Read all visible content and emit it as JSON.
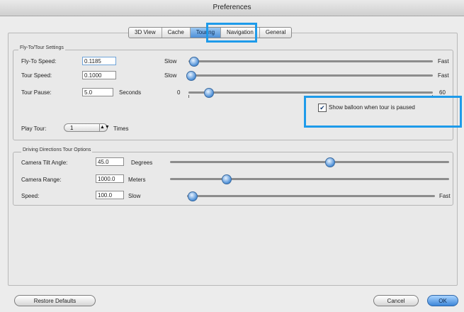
{
  "window": {
    "title": "Preferences"
  },
  "tabs": [
    {
      "label": "3D View",
      "active": false
    },
    {
      "label": "Cache",
      "active": false
    },
    {
      "label": "Touring",
      "active": true
    },
    {
      "label": "Navigation",
      "active": false
    },
    {
      "label": "General",
      "active": false
    }
  ],
  "fly_to_tour": {
    "legend": "Fly-To/Tour Settings",
    "fly_to_speed": {
      "label": "Fly-To Speed:",
      "value": "0.1185",
      "min_label": "Slow",
      "max_label": "Fast",
      "level": 0.02
    },
    "tour_speed": {
      "label": "Tour Speed:",
      "value": "0.1000",
      "min_label": "Slow",
      "max_label": "Fast",
      "level": 0.01
    },
    "tour_pause": {
      "label": "Tour Pause:",
      "value": "5.0",
      "unit": "Seconds",
      "min_label": "0",
      "max_label": "60",
      "level": 0.08
    },
    "show_balloon": {
      "label": "Show balloon when tour is paused",
      "checked": true
    },
    "play_tour": {
      "label": "Play Tour:",
      "value": "1",
      "unit": "Times"
    }
  },
  "driving": {
    "legend": "Driving Directions Tour Options",
    "tilt": {
      "label": "Camera Tilt Angle:",
      "value": "45.0",
      "unit": "Degrees",
      "level": 0.57
    },
    "range": {
      "label": "Camera Range:",
      "value": "1000.0",
      "unit": "Meters",
      "level": 0.2
    },
    "speed": {
      "label": "Speed:",
      "value": "100.0",
      "min_label": "Slow",
      "max_label": "Fast",
      "level": 0.02
    }
  },
  "buttons": {
    "restore": "Restore Defaults",
    "cancel": "Cancel",
    "ok": "OK"
  }
}
